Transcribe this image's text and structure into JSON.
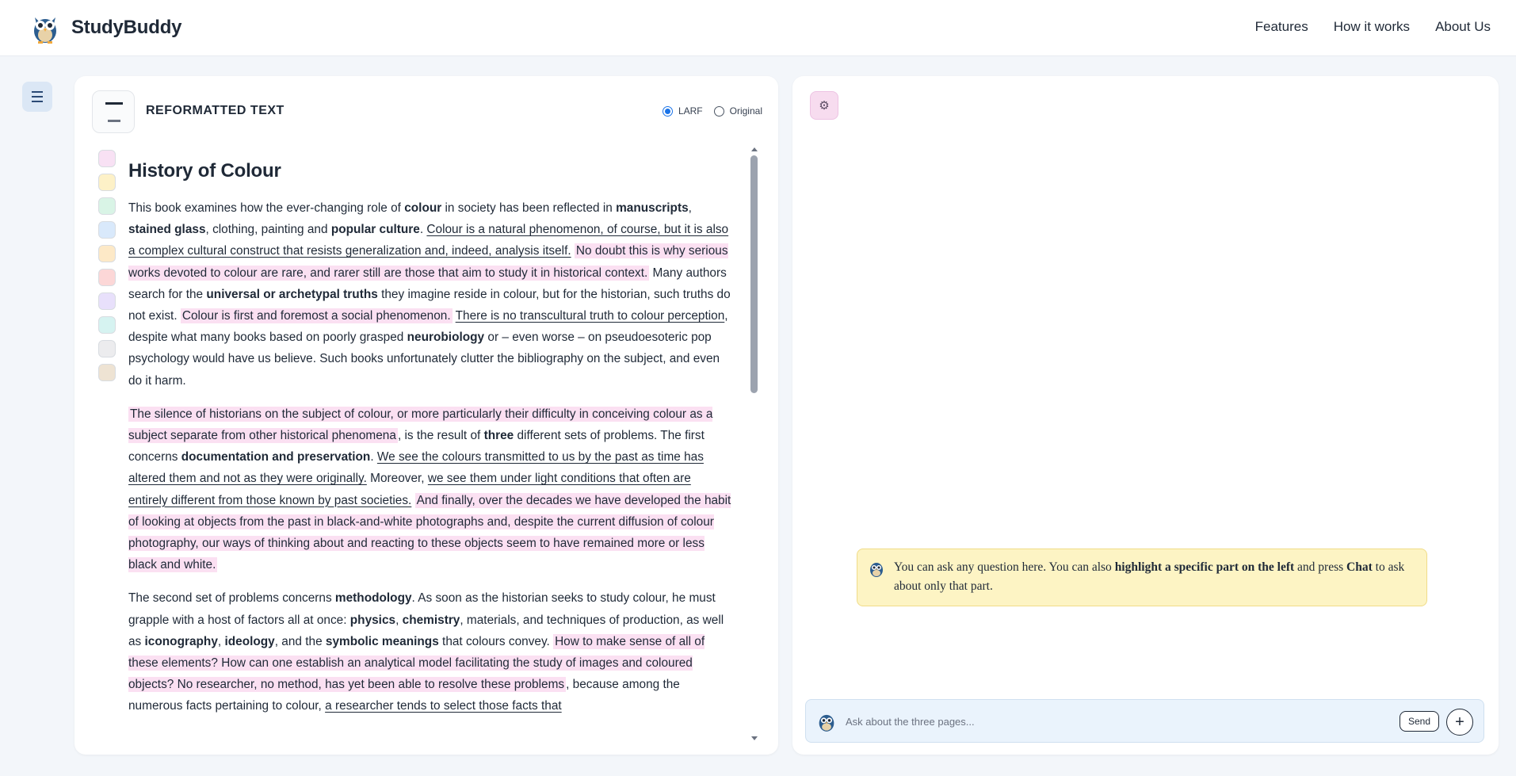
{
  "app": {
    "name": "StudyBuddy"
  },
  "nav": [
    "Features",
    "How it works",
    "About Us"
  ],
  "left_panel": {
    "title": "REFORMATTED TEXT",
    "modes": [
      {
        "label": "LARF",
        "selected": true
      },
      {
        "label": "Original",
        "selected": false
      }
    ],
    "swatches": [
      "#f8e1f4",
      "#fdf1c7",
      "#d9f4e6",
      "#d9e9fb",
      "#fde9c7",
      "#fcd7d7",
      "#e8e0fb",
      "#d6f3f1",
      "#ececee",
      "#eee3d3"
    ],
    "heading": "History of Colour",
    "paragraphs": {
      "p1": [
        "This book examines how the ever-changing role of ",
        "colour",
        " in society has been reflected in ",
        "manuscripts",
        ", ",
        "stained glass",
        ", clothing, painting and ",
        "popular culture",
        ". ",
        "Colour is a natural phenomenon, of course, but it is also a complex cultural construct that resists generalization and, indeed, analysis itself.",
        " ",
        "No doubt this is why serious works devoted to colour are rare, and rarer still are those that aim to study it in historical context.",
        " Many authors search for the ",
        "universal or archetypal truths",
        " they imagine reside in colour, but for the historian, such truths do not exist. ",
        "Colour is first and foremost a social phenomenon.",
        " ",
        "There is no transcultural truth to colour perception",
        ", despite what many books based on poorly grasped ",
        "neurobiology",
        " or – even worse – on pseudoesoteric pop psychology would have us believe. Such books unfortunately clutter the bibliography on the subject, and even do it harm."
      ],
      "p2": [
        "The silence of historians on the subject of colour, or more particularly their difficulty in conceiving colour as a subject separate from other historical phenomena",
        ", is the result of ",
        "three",
        " different sets of problems. The first concerns ",
        "documentation and preservation",
        ". ",
        "We see the colours transmitted to us by the past as time has altered them and not as they were originally.",
        " Moreover, ",
        "we see them under light conditions that often are entirely different from those known by past societies.",
        " ",
        "And finally, over the decades we have developed the habit of looking at objects from the past in black-and-white photographs and, despite the current diffusion of colour photography, our ways of thinking about and reacting to these objects seem to have remained more or less black and white."
      ],
      "p3": [
        "The second set of problems concerns ",
        "methodology",
        ". As soon as the historian seeks to study colour, he must grapple with a host of factors all at once: ",
        "physics",
        ", ",
        "chemistry",
        ", materials, and techniques of production, as well as ",
        "iconography",
        ", ",
        "ideology",
        ", and the ",
        "symbolic meanings",
        " that colours convey. ",
        "How to make sense of all of these elements? How can one establish an analytical model facilitating the study of images and coloured objects? No researcher, no method, has yet been able to resolve these problems",
        ", because among the numerous facts pertaining to colour, ",
        "a researcher tends to select those facts that"
      ]
    }
  },
  "right_panel": {
    "settings_icon": "gear-icon",
    "hint": {
      "part1": "You can ask any question here. You can also ",
      "bold1": "highlight a specific part on the left",
      "part2": " and press ",
      "bold2": "Chat",
      "part3": " to ask about only that part."
    },
    "chat": {
      "placeholder": "Ask about the three pages...",
      "send_label": "Send",
      "plus_label": "+"
    }
  },
  "colors": {
    "highlight": "#fbe0f2",
    "hint_bg": "#fdf4c4",
    "chat_bg": "#eaf3fc",
    "accent": "#1a73e8"
  }
}
